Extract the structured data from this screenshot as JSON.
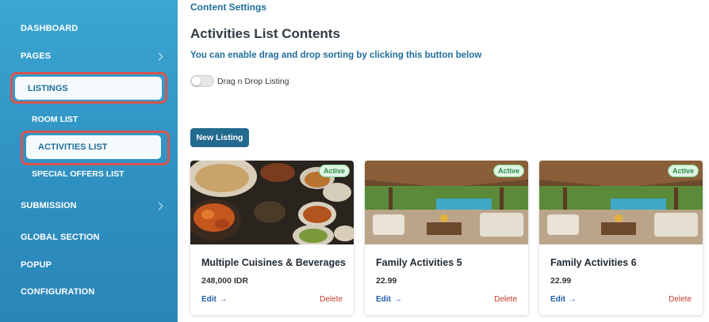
{
  "sidebar": {
    "items": [
      {
        "label": "DASHBOARD"
      },
      {
        "label": "PAGES"
      },
      {
        "label": "LISTINGS"
      },
      {
        "label": "ROOM LIST"
      },
      {
        "label": "ACTIVITIES LIST"
      },
      {
        "label": "SPECIAL OFFERS LIST"
      },
      {
        "label": "SUBMISSION"
      },
      {
        "label": "GLOBAL SECTION"
      },
      {
        "label": "POPUP"
      },
      {
        "label": "CONFIGURATION"
      }
    ],
    "colors": {
      "top": "#3aa6d2",
      "bottom": "#2a86b8",
      "highlight": "#d9534f"
    }
  },
  "main": {
    "breadcrumb": "Content Settings",
    "title": "Activities List Contents",
    "hint": "You can enable drag and drop sorting by clicking this button below",
    "toggle_label": "Drag n Drop Listing",
    "new_listing_label": "New Listing"
  },
  "cards": [
    {
      "badge": "Active",
      "title": "Multiple Cuisines & Beverages",
      "price": "248,000 IDR",
      "edit": "Edit",
      "delete": "Delete",
      "image": "food-photo"
    },
    {
      "badge": "Active",
      "title": "Family Activities 5",
      "price": "22.99",
      "edit": "Edit",
      "delete": "Delete",
      "image": "pavilion-photo"
    },
    {
      "badge": "Active",
      "title": "Family Activities 6",
      "price": "22.99",
      "edit": "Edit",
      "delete": "Delete",
      "image": "pavilion-photo"
    }
  ]
}
